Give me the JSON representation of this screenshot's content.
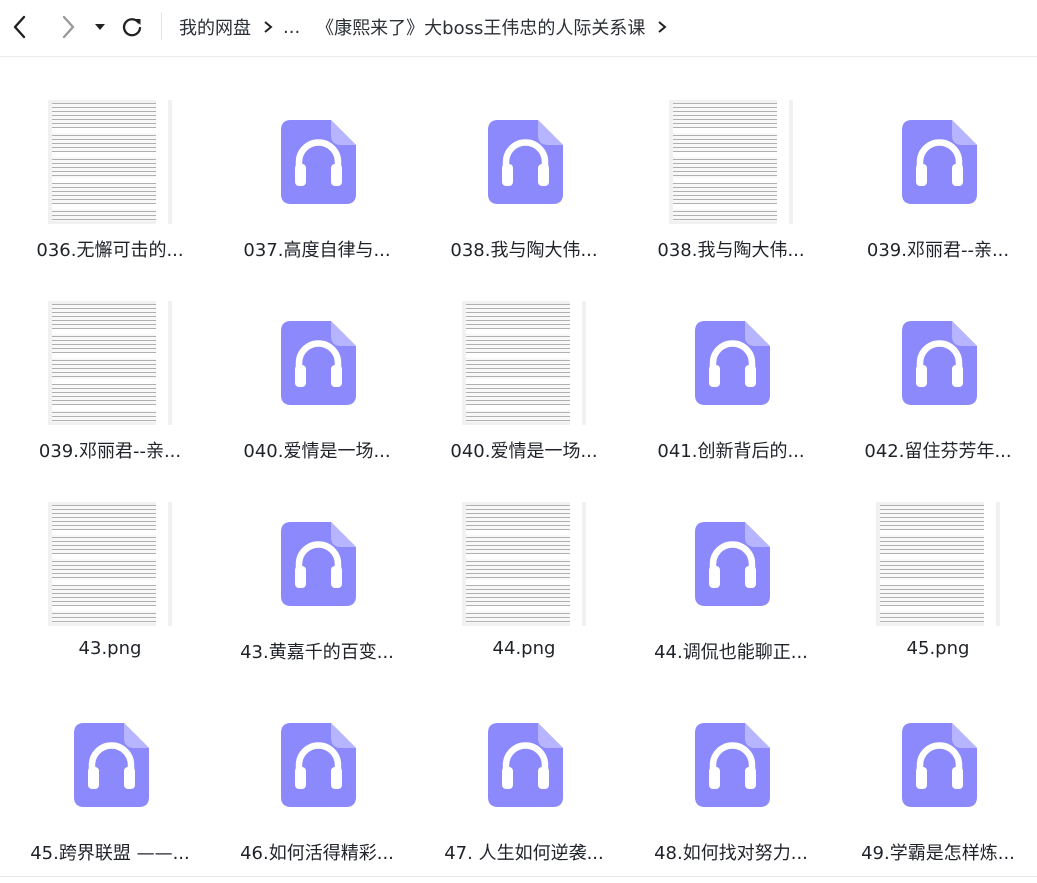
{
  "nav": {
    "back_icon": "chevron-left-icon",
    "forward_icon": "chevron-right-icon",
    "dropdown_icon": "caret-down-icon",
    "refresh_icon": "refresh-icon"
  },
  "breadcrumb": {
    "root": "我的网盘",
    "ellipsis": "...",
    "current": "《康熙来了》大boss王伟忠的人际关系课"
  },
  "colors": {
    "audio_icon_bg": "#8b89fb",
    "audio_icon_fold": "#b7b5ff",
    "text": "#1f2329"
  },
  "files": [
    {
      "name": "036.无懈可击的...",
      "type": "image"
    },
    {
      "name": "037.高度自律与...",
      "type": "audio"
    },
    {
      "name": "038.我与陶大伟...",
      "type": "audio"
    },
    {
      "name": "038.我与陶大伟...",
      "type": "image"
    },
    {
      "name": "039.邓丽君--亲...",
      "type": "audio"
    },
    {
      "name": "039.邓丽君--亲...",
      "type": "image"
    },
    {
      "name": "040.爱情是一场...",
      "type": "audio"
    },
    {
      "name": "040.爱情是一场...",
      "type": "image"
    },
    {
      "name": "041.创新背后的...",
      "type": "audio"
    },
    {
      "name": "042.留住芬芳年...",
      "type": "audio"
    },
    {
      "name": "43.png",
      "type": "image"
    },
    {
      "name": "43.黄嘉千的百变...",
      "type": "audio"
    },
    {
      "name": "44.png",
      "type": "image"
    },
    {
      "name": "44.调侃也能聊正...",
      "type": "audio"
    },
    {
      "name": "45.png",
      "type": "image"
    },
    {
      "name": "45.跨界联盟 ——...",
      "type": "audio"
    },
    {
      "name": "46.如何活得精彩...",
      "type": "audio"
    },
    {
      "name": "47. 人生如何逆袭...",
      "type": "audio"
    },
    {
      "name": "48.如何找对努力...",
      "type": "audio"
    },
    {
      "name": "49.学霸是怎样炼...",
      "type": "audio"
    }
  ]
}
